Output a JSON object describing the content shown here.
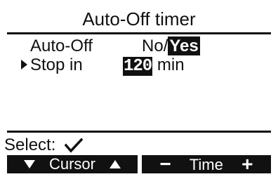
{
  "title": "Auto-Off timer",
  "settings": {
    "auto_off": {
      "label": "Auto-Off",
      "option_no": "No",
      "separator": "/",
      "option_yes": "Yes",
      "selected": "Yes"
    },
    "stop_in": {
      "label": "Stop in",
      "value": "120",
      "unit": "min"
    }
  },
  "footer": {
    "select_label": "Select:",
    "select_icon": "checkmark-icon"
  },
  "softkeys": {
    "left": {
      "label": "Cursor",
      "icon_left": "triangle-down-icon",
      "icon_right": "triangle-up-icon"
    },
    "right": {
      "label": "Time",
      "minus": "−",
      "plus": "+"
    }
  },
  "colors": {
    "background": "#ffffff",
    "foreground": "#111111",
    "highlight_bg": "#111111",
    "highlight_fg": "#ffffff"
  }
}
